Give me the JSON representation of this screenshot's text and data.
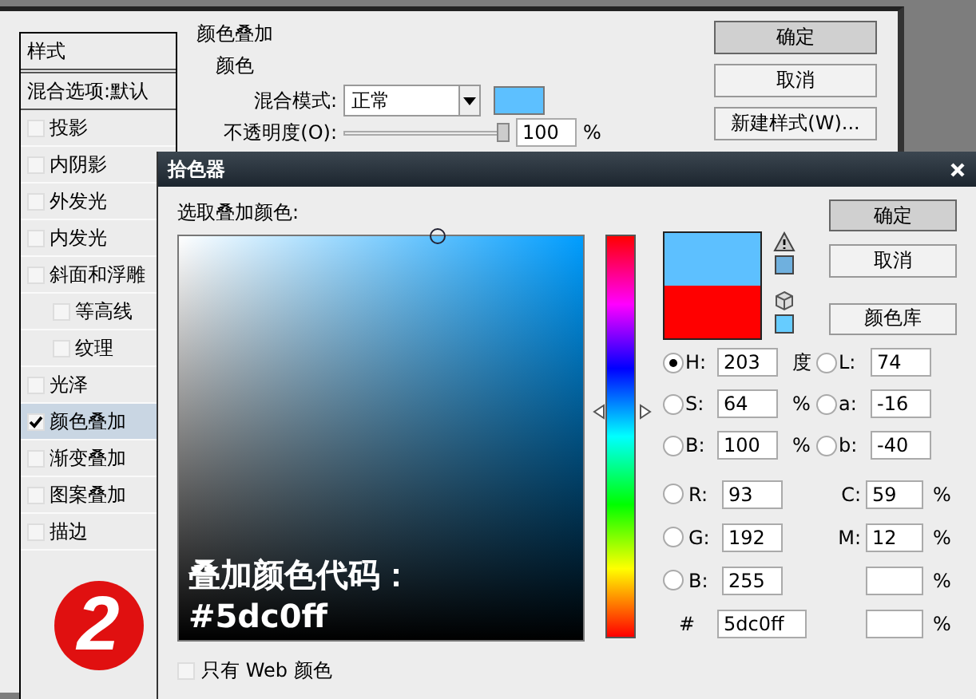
{
  "layer_style": {
    "styles_header": "样式",
    "blend_options": "混合选项:默认",
    "effects": [
      {
        "label": "投影",
        "checked": false,
        "selected": false
      },
      {
        "label": "内阴影",
        "checked": false,
        "selected": false
      },
      {
        "label": "外发光",
        "checked": false,
        "selected": false
      },
      {
        "label": "内发光",
        "checked": false,
        "selected": false
      },
      {
        "label": "斜面和浮雕",
        "checked": false,
        "selected": false,
        "children": [
          {
            "label": "等高线",
            "checked": false,
            "selected": false
          },
          {
            "label": "纹理",
            "checked": false,
            "selected": false
          }
        ]
      },
      {
        "label": "光泽",
        "checked": false,
        "selected": false
      },
      {
        "label": "颜色叠加",
        "checked": true,
        "selected": true
      },
      {
        "label": "渐变叠加",
        "checked": false,
        "selected": false
      },
      {
        "label": "图案叠加",
        "checked": false,
        "selected": false
      },
      {
        "label": "描边",
        "checked": false,
        "selected": false
      }
    ],
    "step_badge": "2",
    "section_title": "颜色叠加",
    "group_title": "颜色",
    "blend_mode": {
      "label": "混合模式:",
      "value": "正常",
      "color": "#5dc0ff"
    },
    "opacity": {
      "label": "不透明度(O):",
      "level": 1,
      "value": "100",
      "unit": "%"
    },
    "buttons": [
      "确定",
      "取消",
      "新建样式(W)..."
    ]
  },
  "color_picker": {
    "title": "拾色器",
    "prompt": "选取叠加颜色:",
    "hue_slider": {
      "level": 0.56
    },
    "swatches": [
      {
        "color": "#5dc0ff"
      },
      {
        "color": "#ff0000"
      }
    ],
    "warning_swatches": [
      {
        "color": "#6fb0de"
      },
      {
        "color": "#66ccff"
      }
    ],
    "buttons": [
      "确定",
      "取消",
      "颜色库"
    ],
    "fields": [
      {
        "label": "H:",
        "value": "203",
        "unit": "度",
        "selected": true
      },
      {
        "label": "L:",
        "value": "74",
        "selected": false
      },
      {
        "label": "S:",
        "value": "64",
        "unit": "%",
        "selected": false
      },
      {
        "label": "a:",
        "value": "-16",
        "selected": false
      },
      {
        "label": "B:",
        "value": "100",
        "unit": "%",
        "selected": false
      },
      {
        "label": "b:",
        "value": "-40",
        "selected": false
      }
    ],
    "rgb": [
      {
        "label": "R:",
        "value": "93",
        "selected": false
      },
      {
        "label": "G:",
        "value": "192",
        "selected": false
      },
      {
        "label": "B:",
        "value": "255",
        "selected": false
      }
    ],
    "cmyk": [
      {
        "label": "C:",
        "value": "59",
        "unit": "%"
      },
      {
        "label": "M:",
        "value": "12",
        "unit": "%"
      },
      {
        "unit": "%"
      },
      {
        "unit": "%"
      }
    ],
    "hex": {
      "label": "#",
      "value": "5dc0ff"
    },
    "web_only": {
      "label": "只有 Web 颜色",
      "checked": false
    },
    "annotation": [
      "叠加颜色代码：",
      "#5dc0ff"
    ]
  }
}
